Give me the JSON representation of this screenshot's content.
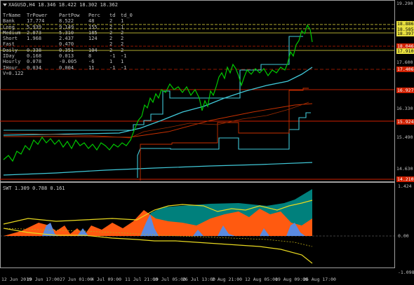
{
  "header": {
    "title": "XAGUSD,H4  18.346 18.422 18.302 18.362"
  },
  "table": {
    "columns": [
      "TrName",
      "TrPower",
      "PartPow",
      "Perc",
      "td",
      "td_0"
    ],
    "rows": [
      [
        "Bank",
        "17.774",
        "8.522",
        "48",
        "2",
        "1"
      ],
      [
        "Long",
        "5.939",
        "9.149",
        "155",
        "2",
        "1"
      ],
      [
        "Medium",
        "2.873",
        "5.310",
        "185",
        "2",
        "2"
      ],
      [
        "Short",
        "1.968",
        "2.437",
        "124",
        "2",
        "2"
      ],
      [
        "Fast",
        "",
        "0.470",
        "",
        "2",
        "2"
      ],
      [
        "Daily",
        "0.338",
        "0.351",
        "104",
        "2",
        "2"
      ],
      [
        "IDay",
        "0.168",
        "0.013",
        "8",
        "-1",
        "-1"
      ],
      [
        "Hourly",
        "0.078",
        "-0.005",
        "-6",
        "1",
        "1"
      ],
      [
        "IHour",
        "0.034",
        "0.004",
        "11",
        "-1",
        "-1"
      ]
    ],
    "v_label": "V=0.122"
  },
  "price_axis": {
    "ticks": [
      "19.290",
      "18.886",
      "18.585",
      "18.397",
      "18.046",
      "17.910",
      "17.600",
      "17.406",
      "16.927",
      "16.330",
      "15.924",
      "15.490",
      "14.630",
      "14.210"
    ]
  },
  "indicator": {
    "label": "SWT 1.309 0.788 0.161",
    "ticks": [
      "1.424",
      "0.00",
      "-1.098"
    ]
  },
  "time_axis": {
    "ticks": [
      "12 Jun 2019",
      "19 Jun 17:00",
      "27 Jun 01:00",
      "4 Jul 09:00",
      "11 Jul 21:00",
      "19 Jul 05:00",
      "26 Jul 13:00",
      "2 Aug 21:00",
      "12 Aug 05:00",
      "19 Aug 09:00",
      "26 Aug 17:00"
    ]
  },
  "colors": {
    "candle": "#00c800",
    "cyan": "#40c8d8",
    "ma_red": "#c83000",
    "level_red": "#d02000",
    "level_yellow": "#e8e040",
    "orange": "#ff5a10",
    "teal": "#00807c",
    "blue": "#5a8ae0",
    "yellow": "#e8d820"
  }
}
